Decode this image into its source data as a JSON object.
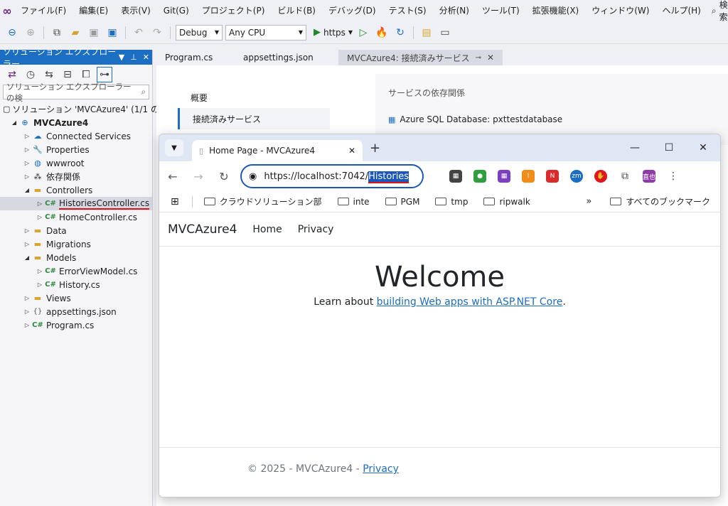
{
  "menubar": {
    "items": [
      "ファイル(F)",
      "編集(E)",
      "表示(V)",
      "Git(G)",
      "プロジェクト(P)",
      "ビルド(B)",
      "デバッグ(D)",
      "テスト(S)",
      "分析(N)",
      "ツール(T)",
      "拡張機能(X)",
      "ウィンドウ(W)",
      "ヘルプ(H)"
    ],
    "search": "検索"
  },
  "toolbar": {
    "config": "Debug",
    "platform": "Any CPU",
    "run_label": "https"
  },
  "solution_explorer": {
    "title": "ソリューション エクスプローラー",
    "search_placeholder": "ソリューション エクスプローラー の検",
    "solution": "ソリューション 'MVCAzure4' (1/1 の",
    "project": "MVCAzure4",
    "items": {
      "connected": "Connected Services",
      "properties": "Properties",
      "wwwroot": "wwwroot",
      "deps": "依存関係",
      "controllers": "Controllers",
      "histories_ctrl": "HistoriesController.cs",
      "home_ctrl": "HomeController.cs",
      "data": "Data",
      "migrations": "Migrations",
      "models": "Models",
      "error_model": "ErrorViewModel.cs",
      "history": "History.cs",
      "views": "Views",
      "appsettings": "appsettings.json",
      "program": "Program.cs"
    }
  },
  "doc_tabs": [
    "Program.cs",
    "appsettings.json",
    "MVCAzure4: 接続済みサービス"
  ],
  "connected_services": {
    "nav": [
      "概要",
      "接続済みサービス"
    ],
    "panel_header": "サービスの依存関係",
    "service": "Azure SQL Database: pxttestdatabase"
  },
  "browser": {
    "tab_title": "Home Page - MVCAzure4",
    "url_base": "https://localhost:7042/",
    "url_selected": "Histories",
    "bookmarks": [
      "クラウドソリューション部",
      "inte",
      "PGM",
      "tmp",
      "ripwalk"
    ],
    "all_bookmarks": "すべてのブックマーク",
    "avatar_text": "直也"
  },
  "site": {
    "brand": "MVCAzure4",
    "nav": [
      "Home",
      "Privacy"
    ],
    "heading": "Welcome",
    "learn_prefix": "Learn about ",
    "learn_link": "building Web apps with ASP.NET Core",
    "learn_suffix": ".",
    "footer_text": "© 2025 - MVCAzure4 - ",
    "footer_link": "Privacy"
  }
}
